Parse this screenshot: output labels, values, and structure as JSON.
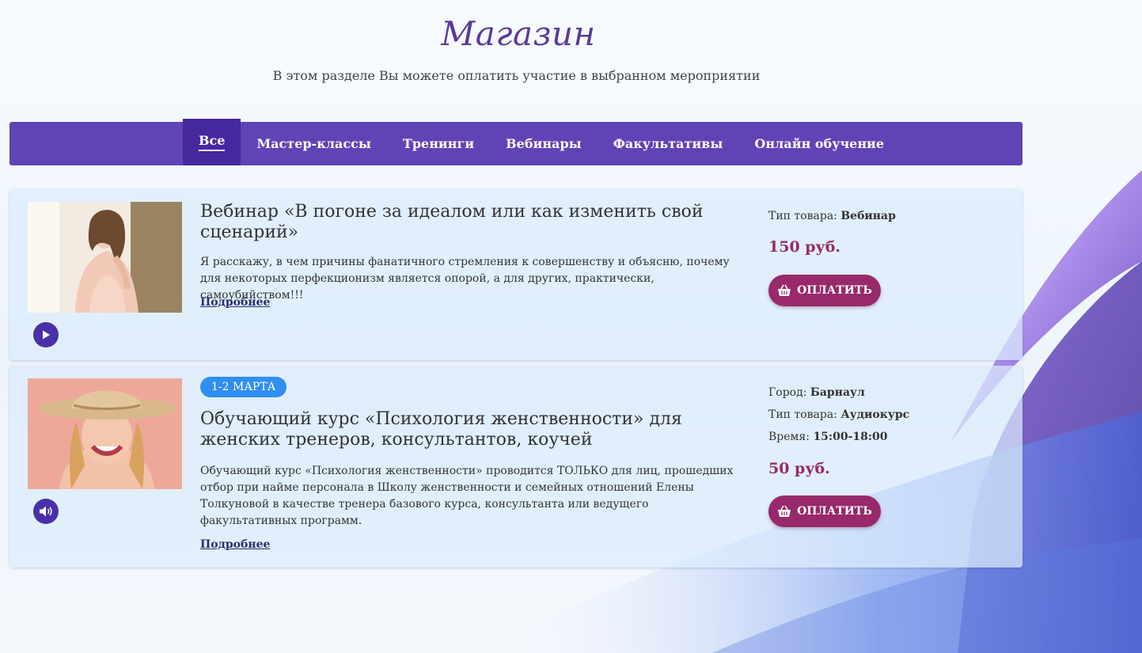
{
  "page": {
    "title": "Магазин",
    "subtitle": "В этом разделе Вы можете оплатить участие в выбранном мероприятии"
  },
  "nav": {
    "tabs": [
      {
        "label": "Все",
        "active": true
      },
      {
        "label": "Мастер-классы"
      },
      {
        "label": "Тренинги"
      },
      {
        "label": "Вебинары"
      },
      {
        "label": "Факультативы"
      },
      {
        "label": "Онлайн обучение"
      }
    ]
  },
  "items": [
    {
      "title": "Вебинар «В погоне за идеалом или как изменить свой сценарий»",
      "description": "Я расскажу, в чем причины фанатичного стремления к совершенству и объясню, почему для некоторых перфекционизм является опорой, а для других, практически, самоубийством!!!",
      "more_label": "Подробнее",
      "media_icon": "play-icon",
      "meta": [
        {
          "label": "Тип товара:",
          "value": "Вебинар"
        }
      ],
      "price": "150 руб.",
      "pay_label": "ОПЛАТИТЬ"
    },
    {
      "date_badge": "1-2 МАРТА",
      "title": "Обучающий курс «Психология женственности» для женских тренеров, консультантов, коучей",
      "description": "Обучающий курс «Психология женственности» проводится ТОЛЬКО для лиц, прошедших отбор при найме персонала в Школу женственности и семейных отношений Елены Толкуновой в качестве тренера базового курса, консультанта или ведущего факультативных программ.",
      "more_label": "Подробнее",
      "media_icon": "speaker-icon",
      "meta": [
        {
          "label": "Город:",
          "value": "Барнаул"
        },
        {
          "label": "Тип товара:",
          "value": "Аудиокурс"
        },
        {
          "label": "Время:",
          "value": "15:00-18:00"
        }
      ],
      "price": "50 руб.",
      "pay_label": "ОПЛАТИТЬ"
    }
  ],
  "colors": {
    "nav": "#6044b6",
    "nav_active": "#46289e",
    "price": "#98296a",
    "pay_button": "#98296a",
    "badge": "#2f8ff0",
    "title": "#5b3a9a"
  }
}
